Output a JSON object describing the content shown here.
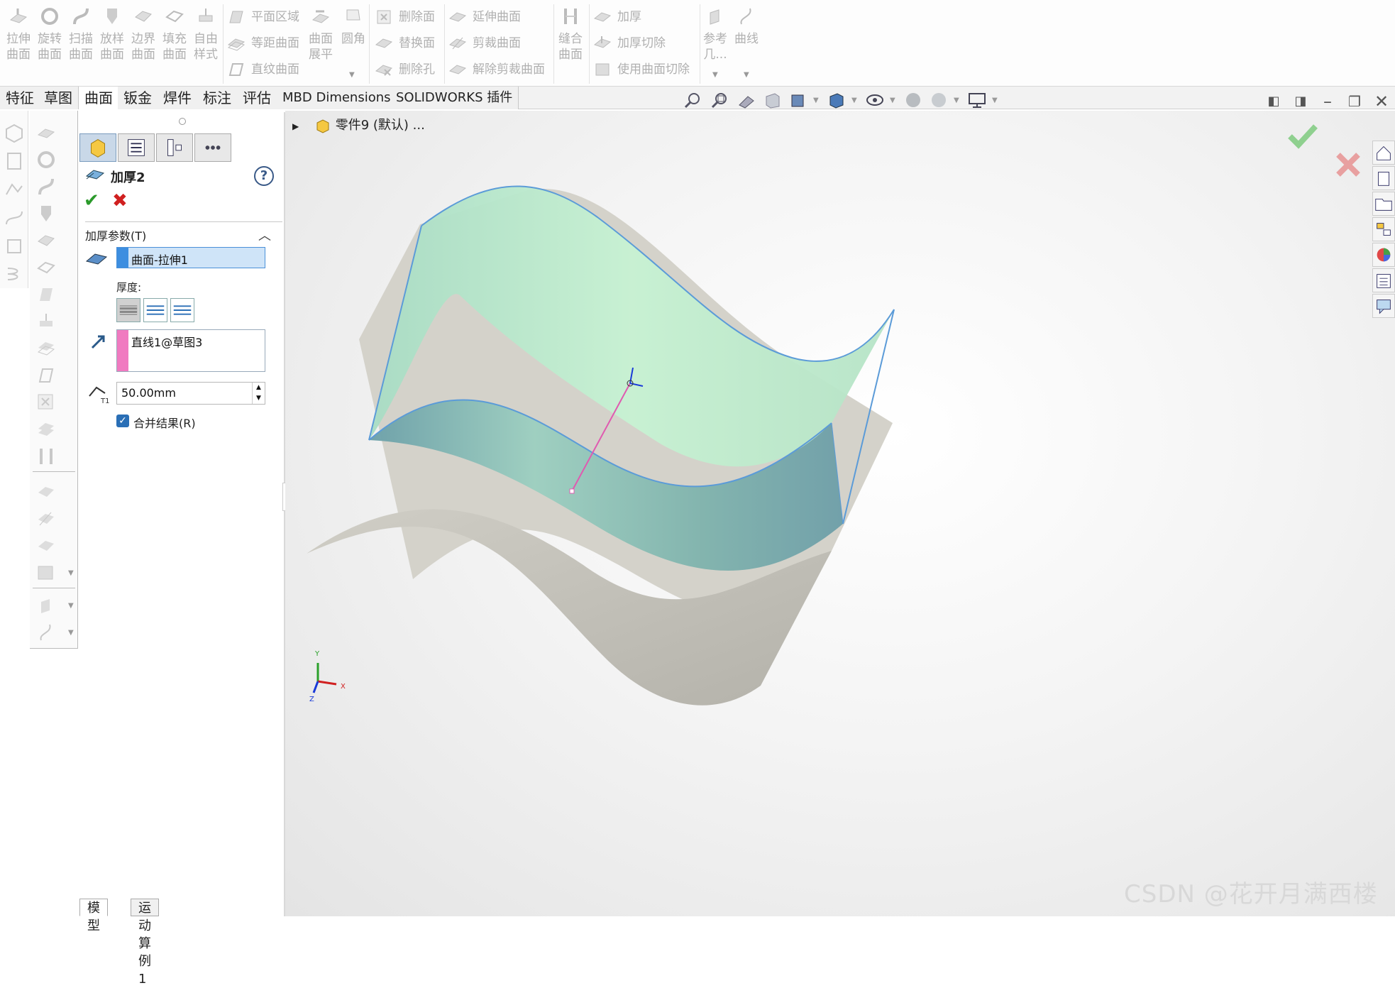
{
  "ribbon": {
    "big_buttons": [
      {
        "label": "拉伸\n曲面"
      },
      {
        "label": "旋转\n曲面"
      },
      {
        "label": "扫描\n曲面"
      },
      {
        "label": "放样\n曲面"
      },
      {
        "label": "边界\n曲面"
      },
      {
        "label": "填充\n曲面"
      },
      {
        "label": "自由\n样式"
      }
    ],
    "group2": {
      "planar": "平面区域",
      "offset": "等距曲面",
      "ruled": "直纹曲面",
      "flatten": "曲面\n展平",
      "fillet": "圆角"
    },
    "group3": {
      "delete_face": "删除面",
      "replace_face": "替换面",
      "delete_hole": "删除孔"
    },
    "group4": {
      "extend": "延伸曲面",
      "trim": "剪裁曲面",
      "untrim": "解除剪裁曲面"
    },
    "group5": {
      "knit": "缝合\n曲面"
    },
    "group6": {
      "thicken": "加厚",
      "thicken_cut": "加厚切除",
      "surface_cut": "使用曲面切除"
    },
    "group7": {
      "ref_geom": "参考\n几...",
      "curves": "曲线"
    }
  },
  "tabs": [
    {
      "label": "特征"
    },
    {
      "label": "草图"
    },
    {
      "label": "曲面"
    },
    {
      "label": "钣金"
    },
    {
      "label": "焊件"
    },
    {
      "label": "标注"
    },
    {
      "label": "评估"
    },
    {
      "label": "MBD Dimensions"
    },
    {
      "label": "SOLIDWORKS 插件"
    }
  ],
  "active_tab": "曲面",
  "property_manager": {
    "title": "加厚2",
    "section_title": "加厚参数(T)",
    "surface_selection": "曲面-拉伸1",
    "thickness_label": "厚度:",
    "direction_selection": "直线1@草图3",
    "thickness_value": "50.00mm",
    "merge_result_label": "合并结果(R)",
    "merge_result_checked": true,
    "help_label": "?"
  },
  "viewport": {
    "tree_item": "零件9 (默认) ..."
  },
  "bottom_tabs": [
    {
      "label": "模型"
    },
    {
      "label": "运动算例 1"
    }
  ],
  "triad": {
    "x": "X",
    "y": "Y",
    "z": "Z"
  },
  "watermark": "CSDN @花开月满西楼",
  "colors": {
    "surface_green": "#c3f0cb",
    "surface_gray": "#c4c2bc",
    "edge_blue": "#5b9bd8",
    "sketch_pink": "#e05ab0",
    "ok_green": "#2b9a2b",
    "cancel_red": "#d02020"
  }
}
